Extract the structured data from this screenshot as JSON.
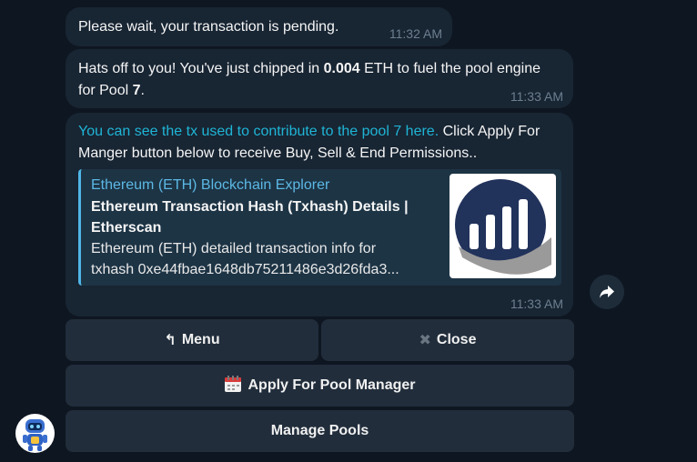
{
  "messages": [
    {
      "text": "Please wait, your transaction is pending.",
      "time": "11:32 AM"
    },
    {
      "text_before": "Hats off to you! You've just chipped in ",
      "amount": "0.004",
      "text_mid": " ETH to fuel the pool engine for Pool ",
      "pool": "7",
      "text_end": ".",
      "time": "11:33 AM"
    },
    {
      "link_text": "You can see the tx used to contribute to the pool 7 here.",
      "text_after": " Click Apply For Manger button below to receive Buy, Sell & End Permissions..",
      "time": "11:33 AM",
      "preview": {
        "site": "Ethereum (ETH) Blockchain Explorer",
        "title": "Ethereum Transaction Hash (Txhash) Details | Etherscan",
        "desc_line1": "Ethereum (ETH) detailed transaction info for",
        "desc_line2": "txhash 0xe44fbae1648db75211486e3d26fda3..."
      }
    }
  ],
  "keyboard": {
    "menu_icon": "↰",
    "menu_label": "Menu",
    "close_icon": "✖",
    "close_label": "Close",
    "apply_icon": "calendar-icon",
    "apply_label": "Apply For Pool Manager",
    "manage_label": "Manage Pools"
  },
  "colors": {
    "background": "#0e1621",
    "bubble": "#182533",
    "link": "#1fb5d6",
    "preview_site": "#5cb8e4"
  }
}
